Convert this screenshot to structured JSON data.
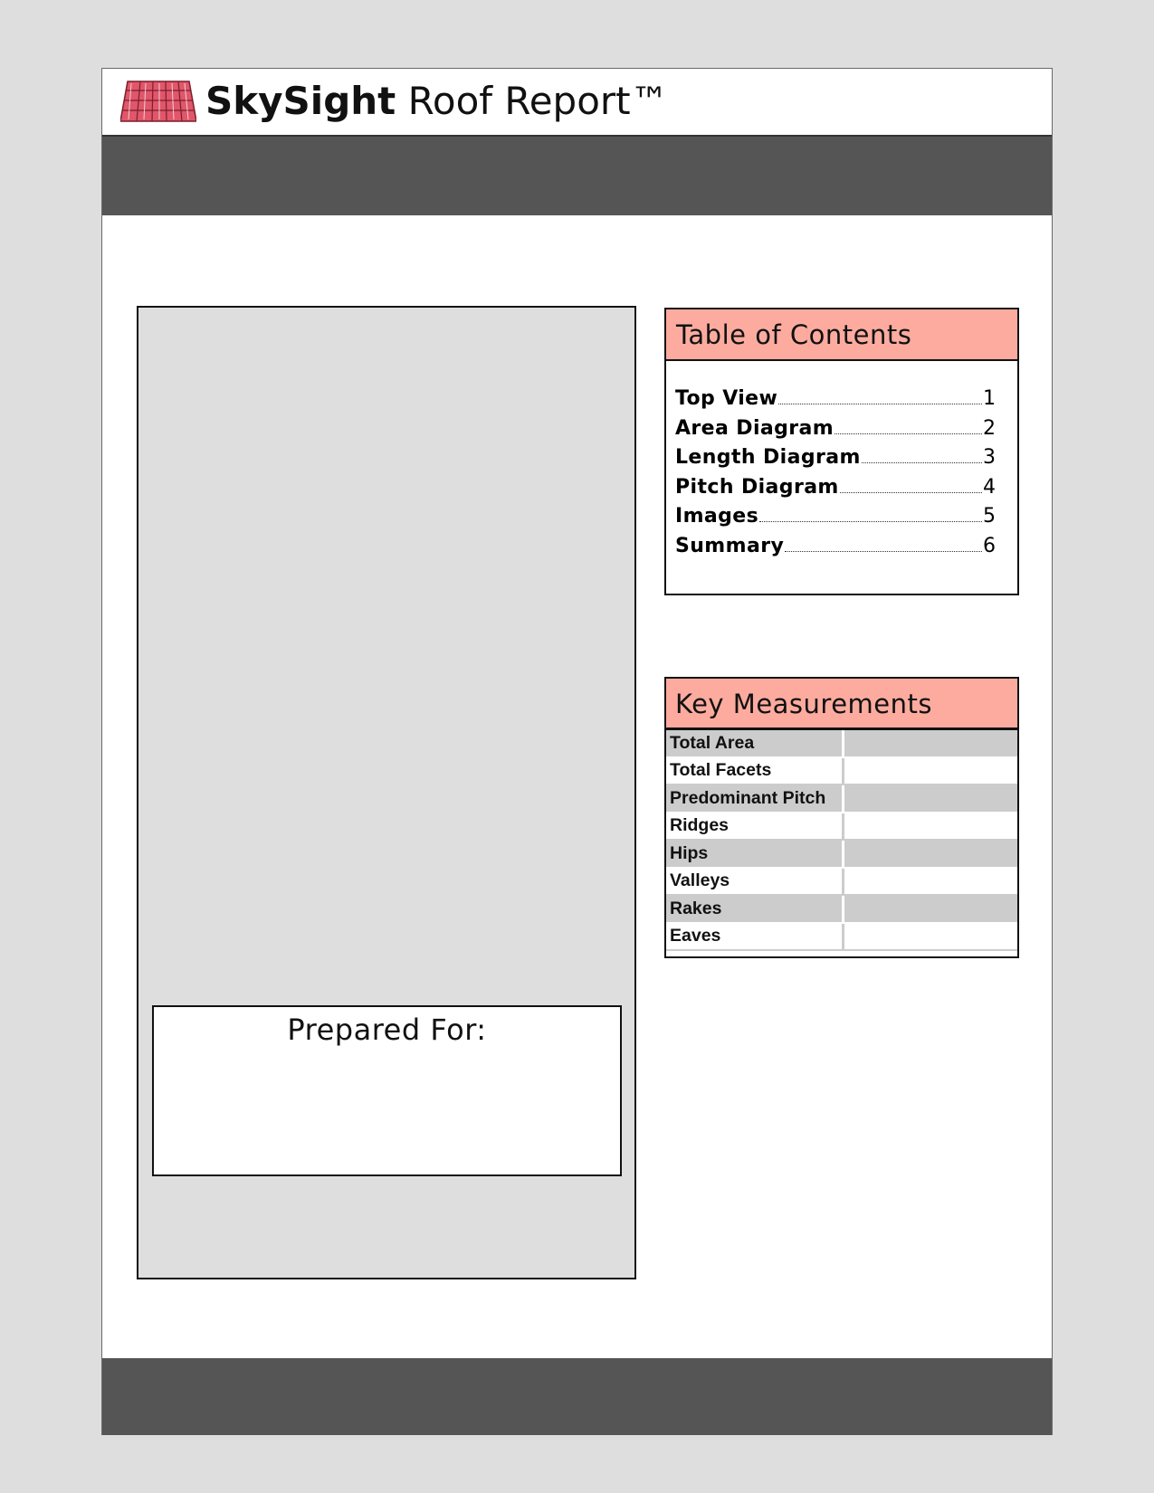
{
  "header": {
    "brand_bold": "SkySight",
    "brand_rest": " Roof Report™",
    "logo_icon": "roof-tiles-icon",
    "logo_color": "#e0566a"
  },
  "colors": {
    "band": "#555555",
    "panel_header": "#fdab9f",
    "row_shade": "#cccccc",
    "background": "#dedede"
  },
  "cover": {
    "prepared_for_label": "Prepared For:"
  },
  "toc": {
    "title": "Table of Contents",
    "items": [
      {
        "label": "Top View",
        "page": "1"
      },
      {
        "label": "Area Diagram",
        "page": "2"
      },
      {
        "label": "Length Diagram",
        "page": "3"
      },
      {
        "label": "Pitch Diagram",
        "page": "4"
      },
      {
        "label": "Images",
        "page": "5"
      },
      {
        "label": "Summary",
        "page": "6"
      }
    ]
  },
  "key_measurements": {
    "title": "Key Measurements",
    "rows": [
      {
        "label": "Total Area",
        "value": ""
      },
      {
        "label": "Total Facets",
        "value": ""
      },
      {
        "label": "Predominant Pitch",
        "value": ""
      },
      {
        "label": "Ridges",
        "value": ""
      },
      {
        "label": "Hips",
        "value": ""
      },
      {
        "label": "Valleys",
        "value": ""
      },
      {
        "label": "Rakes",
        "value": ""
      },
      {
        "label": "Eaves",
        "value": ""
      }
    ]
  }
}
